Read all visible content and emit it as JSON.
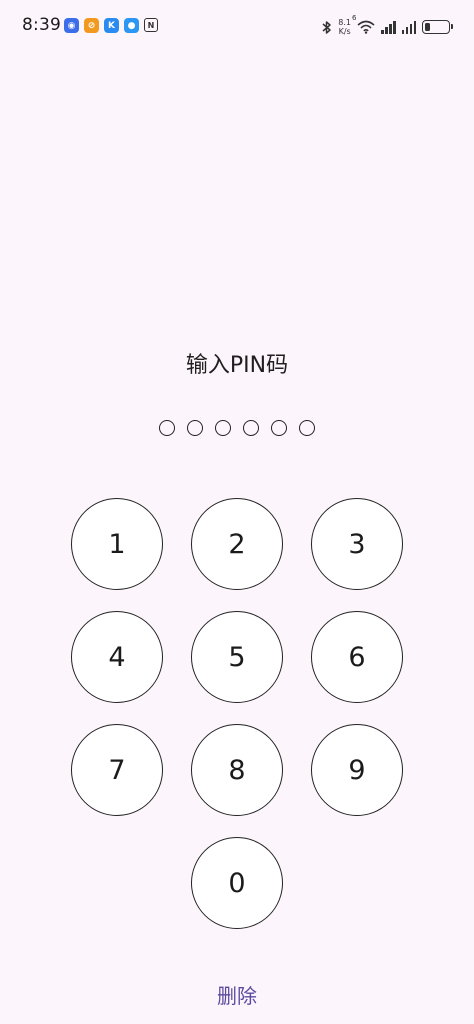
{
  "status_bar": {
    "time": "8:39",
    "net_speed_value": "8.1",
    "net_speed_unit": "K/s",
    "wifi_badge": "6",
    "battery_level": 0.25,
    "app_icons": [
      {
        "name": "browser-app-icon",
        "color": "#3b6ee8",
        "glyph": "◉"
      },
      {
        "name": "orange-app-icon",
        "color": "#f29a1f",
        "glyph": "⊘"
      },
      {
        "name": "blue-app-icon",
        "color": "#2a8cf0",
        "glyph": "K"
      },
      {
        "name": "message-app-icon",
        "color": "#2b96f3",
        "glyph": "●"
      },
      {
        "name": "nfc-icon",
        "color": "#333333",
        "glyph": "N"
      }
    ]
  },
  "title": "输入PIN码",
  "pin_length": 6,
  "keys": [
    "1",
    "2",
    "3",
    "4",
    "5",
    "6",
    "7",
    "8",
    "9",
    "0"
  ],
  "delete_label": "删除",
  "colors": {
    "background": "#fdf5fc",
    "accent": "#5a4ba0",
    "key_fill": "#ffffff",
    "key_border": "#222222"
  }
}
